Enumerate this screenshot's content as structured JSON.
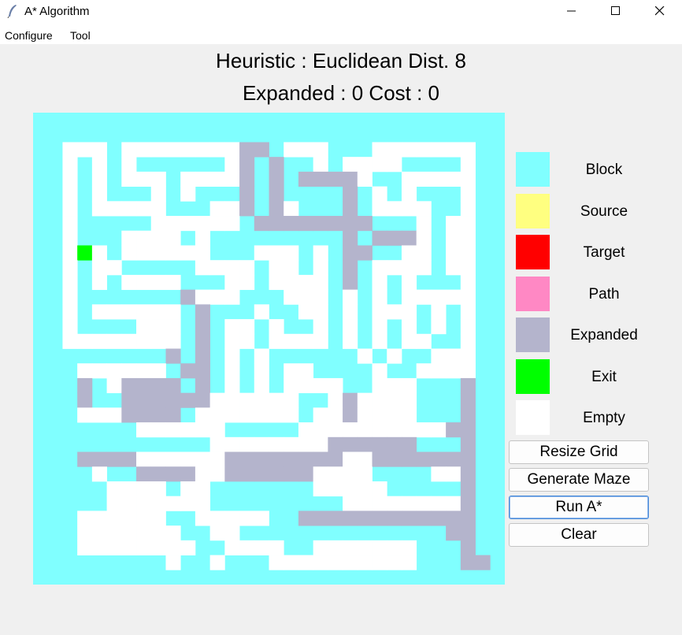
{
  "window": {
    "title": "A* Algorithm"
  },
  "menu": [
    "Configure",
    "Tool"
  ],
  "status": {
    "heuristic": "Heuristic : Euclidean Dist. 8",
    "stats": "Expanded : 0 Cost : 0"
  },
  "legend": [
    {
      "label": "Block",
      "color": "#80ffff"
    },
    {
      "label": "Source",
      "color": "#ffff80"
    },
    {
      "label": "Target",
      "color": "#ff0000"
    },
    {
      "label": "Path",
      "color": "#ff88c4"
    },
    {
      "label": "Expanded",
      "color": "#b4b4cc"
    },
    {
      "label": "Exit",
      "color": "#00ff00"
    },
    {
      "label": "Empty",
      "color": "#ffffff"
    }
  ],
  "buttons": {
    "resize": "Resize Grid",
    "generate": "Generate Maze",
    "run": "Run A*",
    "clear": "Clear"
  },
  "maze": {
    "cells": {
      "1": "#ffffff",
      "2": "#b4b4cc",
      "3": "#00ff00",
      "4": "#ffff80"
    },
    "rows": [
      "00000000000000000000000000000000",
      "00000000000000000000000000000000",
      "00111011111111220111000111111100",
      "00101010000001202001011110000100",
      "00101011101111202022221001111100",
      "00101000101000202000020101000100",
      "00101111100011202100020111100100",
      "00100000111111022222222000101100",
      "00100011110100000000020222101100",
      "00131011111100011101022001101100",
      "00101100000111101101020111101100",
      "00101011110001101111020101000100",
      "00100000002111000111010101111100",
      "00101111110200010011010111010100",
      "00100001110201101001010101010100",
      "00111111110201101111010101100100",
      "00000000020201010000001010011100",
      "00011111102201010110000100111100",
      "00020122220201010111100111000200",
      "00020022222211111100121111000200",
      "00011122220111111101121111000200",
      "00000001111110000011111111112200",
      "00000000000011111111222222000200",
      "00022221111112222222211222222200",
      "00001002222112222221111000011200",
      "00000111101100000001111100000200",
      "00000111111100000000011111111200",
      "00011111100111110022222222222200",
      "00011111110011000000000000002200",
      "00011111111001111001111111000200",
      "00000000010010001111111111000220",
      "00000000000000000000000000000000"
    ]
  }
}
